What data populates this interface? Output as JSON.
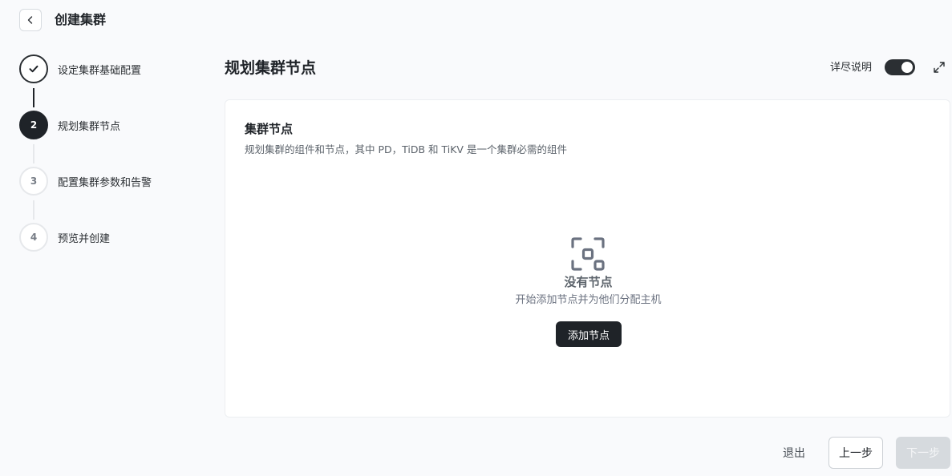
{
  "header": {
    "title": "创建集群"
  },
  "steps": [
    {
      "number": "",
      "label": "设定集群基础配置",
      "status": "done"
    },
    {
      "number": "2",
      "label": "规划集群节点",
      "status": "active"
    },
    {
      "number": "3",
      "label": "配置集群参数和告警",
      "status": "pending"
    },
    {
      "number": "4",
      "label": "预览并创建",
      "status": "pending"
    }
  ],
  "section": {
    "title": "规划集群节点",
    "detail_toggle_label": "详尽说明",
    "detail_toggle_on": true
  },
  "card": {
    "title": "集群节点",
    "description": "规划集群的组件和节点，其中 PD，TiDB 和 TiKV 是一个集群必需的组件",
    "empty": {
      "icon": "nodes-empty-icon",
      "title": "没有节点",
      "description": "开始添加节点并为他们分配主机",
      "button_label": "添加节点"
    }
  },
  "footer": {
    "exit_label": "退出",
    "prev_label": "上一步",
    "next_label": "下一步"
  },
  "colors": {
    "primary_dark": "#1f2328",
    "border": "#e6e8eb",
    "disabled": "#d6dade"
  }
}
